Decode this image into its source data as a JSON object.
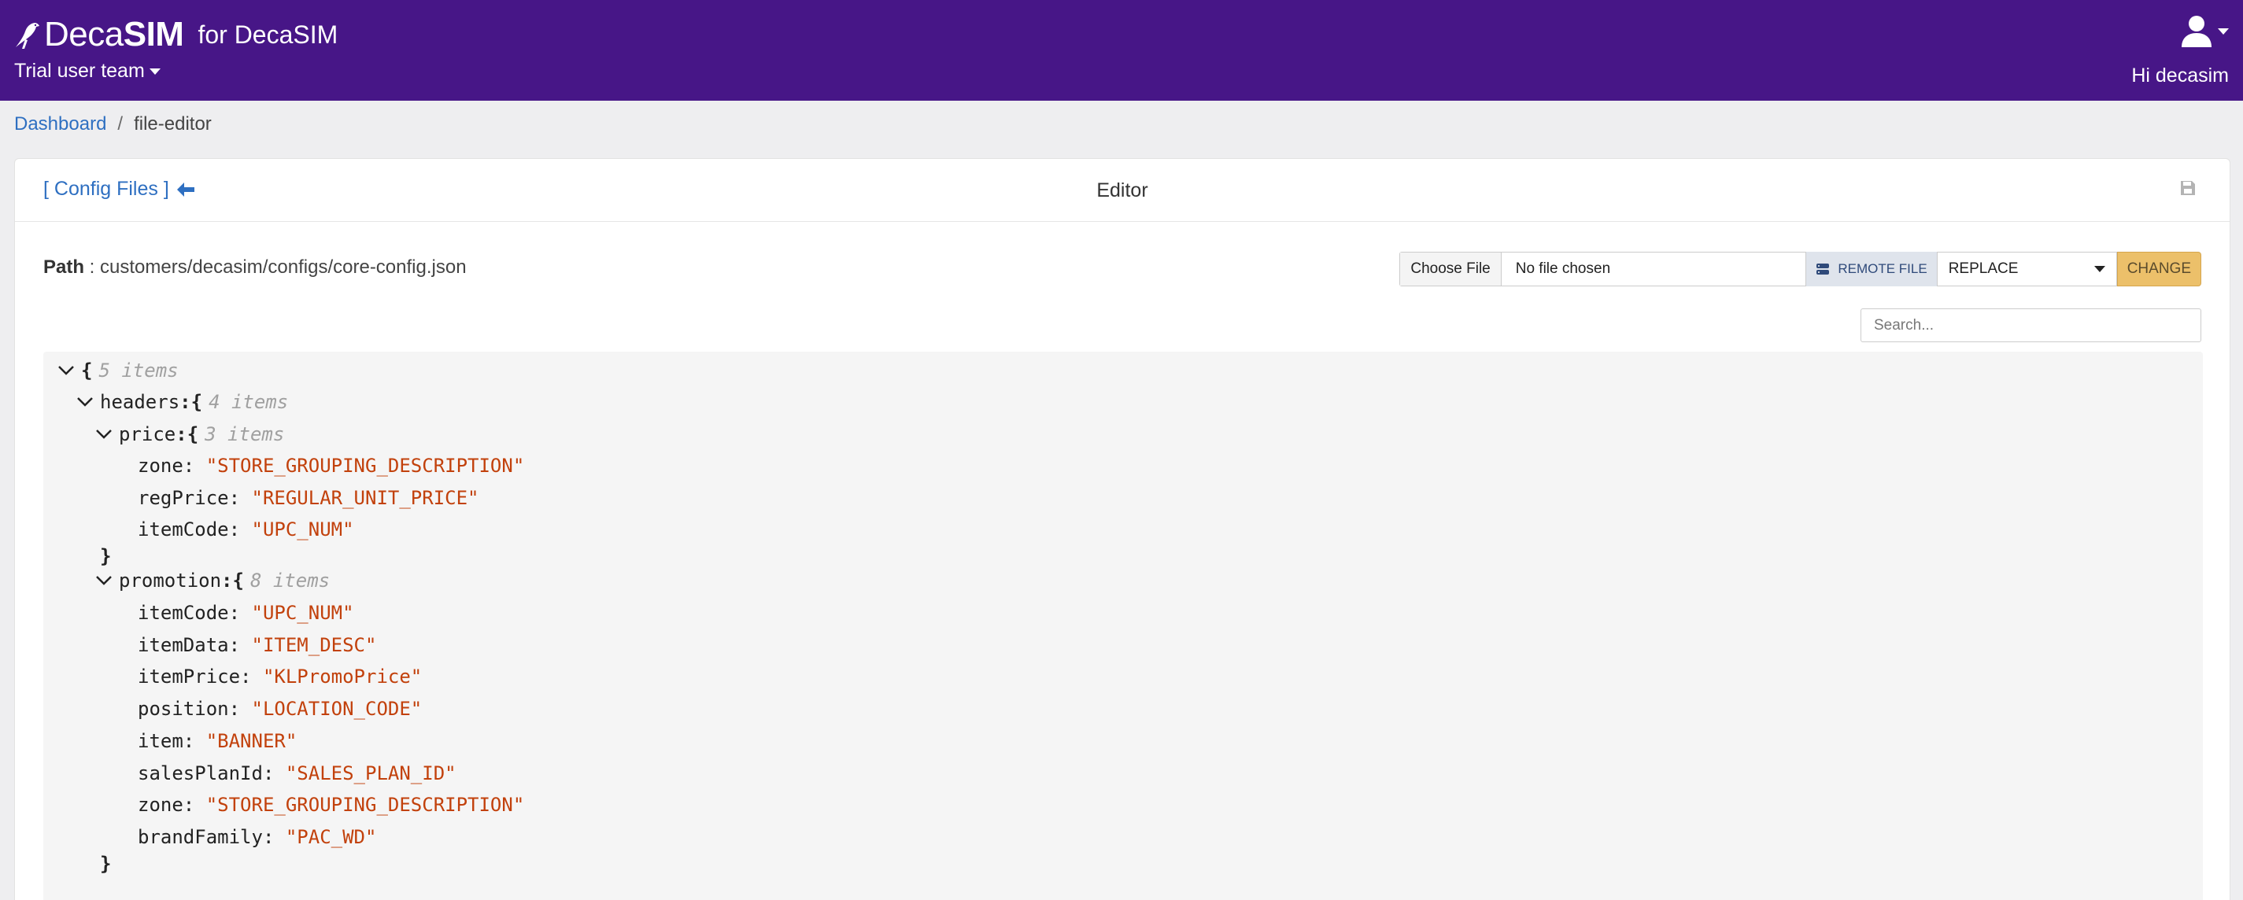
{
  "header": {
    "brand_deca": "Deca",
    "brand_sim": "SIM",
    "brand_for": "for DecaSIM",
    "team": "Trial user team",
    "greeting": "Hi decasim"
  },
  "breadcrumb": {
    "home": "Dashboard",
    "separator": "/",
    "current": "file-editor"
  },
  "card": {
    "back_link": "[ Config Files ]",
    "title": "Editor"
  },
  "path": {
    "label": "Path",
    "value": " : customers/decasim/configs/core-config.json"
  },
  "file_controls": {
    "choose_button": "Choose File",
    "no_file": "No file chosen",
    "remote": "REMOTE FILE",
    "mode_selected": "REPLACE",
    "change_button": "CHANGE"
  },
  "search": {
    "placeholder": "Search..."
  },
  "json_tree": {
    "root_count": "5 items",
    "headers_key": "headers",
    "headers_count": "4 items",
    "price_key": "price",
    "price_count": "3 items",
    "price": [
      {
        "key": "zone",
        "value": "\"STORE_GROUPING_DESCRIPTION\""
      },
      {
        "key": "regPrice",
        "value": "\"REGULAR_UNIT_PRICE\""
      },
      {
        "key": "itemCode",
        "value": "\"UPC_NUM\""
      }
    ],
    "promotion_key": "promotion",
    "promotion_count": "8 items",
    "promotion": [
      {
        "key": "itemCode",
        "value": "\"UPC_NUM\""
      },
      {
        "key": "itemData",
        "value": "\"ITEM_DESC\""
      },
      {
        "key": "itemPrice",
        "value": "\"KLPromoPrice\""
      },
      {
        "key": "position",
        "value": "\"LOCATION_CODE\""
      },
      {
        "key": "item",
        "value": "\"BANNER\""
      },
      {
        "key": "salesPlanId",
        "value": "\"SALES_PLAN_ID\""
      },
      {
        "key": "zone",
        "value": "\"STORE_GROUPING_DESCRIPTION\""
      },
      {
        "key": "brandFamily",
        "value": "\"PAC_WD\""
      }
    ]
  },
  "colors": {
    "header_bg": "#471687",
    "link": "#2e6fc1",
    "json_string": "#c2410c",
    "change_button": "#ecc06a"
  }
}
